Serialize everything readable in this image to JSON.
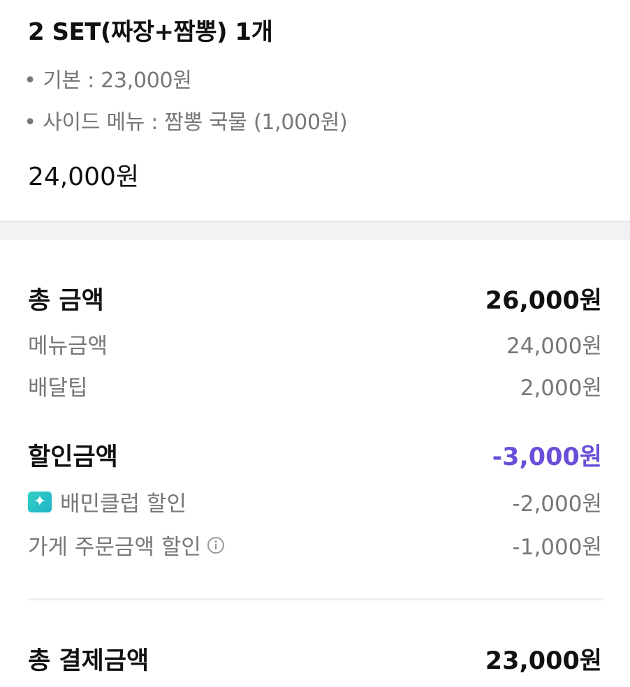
{
  "order_item": {
    "title": "2 SET(짜장+짬뽕) 1개",
    "options": [
      {
        "bullet": "•",
        "text": "기본 : 23,000원"
      },
      {
        "bullet": "•",
        "text": "사이드 메뉴 : 짬뽕 국물 (1,000원)"
      }
    ],
    "price": "24,000원"
  },
  "summary": {
    "total_label": "총 금액",
    "total_value": "26,000원",
    "menu_label": "메뉴금액",
    "menu_value": "24,000원",
    "delivery_label": "배달팁",
    "delivery_value": "2,000원",
    "discount_label": "할인금액",
    "discount_value": "-3,000원",
    "club_label": "배민클럽 할인",
    "club_value": "-2,000원",
    "store_label": "가게 주문금액 할인",
    "store_value": "-1,000원",
    "pay_label": "총 결제금액",
    "pay_value": "23,000원"
  },
  "colors": {
    "discount": "#6a4ed8",
    "club_icon": "#1fb2c9"
  },
  "icons": {
    "club": "sparkle-icon",
    "info": "info-icon"
  }
}
